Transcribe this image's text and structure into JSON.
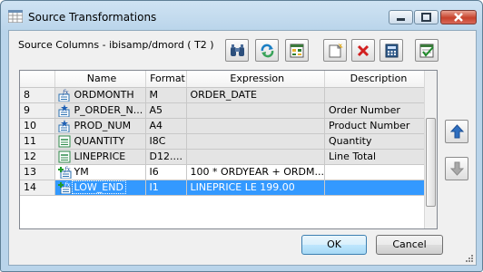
{
  "window": {
    "title": "Source Transformations"
  },
  "source_label": "Source Columns - ibisamp/dmord ( T2 )",
  "columns": [
    "",
    "Name",
    "Format",
    "Expression",
    "Description"
  ],
  "rows": [
    {
      "num": "8",
      "name": "ORDMONTH",
      "format": "M",
      "expression": "ORDER_DATE",
      "description": "",
      "icon": "fx-field-icon",
      "style": "gray"
    },
    {
      "num": "9",
      "name": "P_ORDER_N...",
      "format": "A5",
      "expression": "",
      "description": "Order Number",
      "icon": "key-field-icon",
      "style": "gray"
    },
    {
      "num": "10",
      "name": "PROD_NUM",
      "format": "A4",
      "expression": "",
      "description": "Product Number",
      "icon": "key-field-icon",
      "style": "gray"
    },
    {
      "num": "11",
      "name": "QUANTITY",
      "format": "I8C",
      "expression": "",
      "description": "Quantity",
      "icon": "measure-field-icon",
      "style": "gray"
    },
    {
      "num": "12",
      "name": "LINEPRICE",
      "format": "D12....",
      "expression": "",
      "description": "Line Total",
      "icon": "measure-field-icon",
      "style": "gray"
    },
    {
      "num": "13",
      "name": "YM",
      "format": "I6",
      "expression": "100 * ORDYEAR + ORDM...",
      "description": "",
      "icon": "new-fx-field-icon",
      "style": "white"
    },
    {
      "num": "14",
      "name": "LOW_END",
      "format": "I1",
      "expression": "LINEPRICE LE 199.00",
      "description": "",
      "icon": "new-fx-field-icon",
      "style": "selected"
    }
  ],
  "buttons": {
    "ok": "OK",
    "cancel": "Cancel"
  },
  "colors": {
    "selection": "#3399ff",
    "readonly_row": "#e4e4e4",
    "window_frame": "#b9d4ea"
  }
}
